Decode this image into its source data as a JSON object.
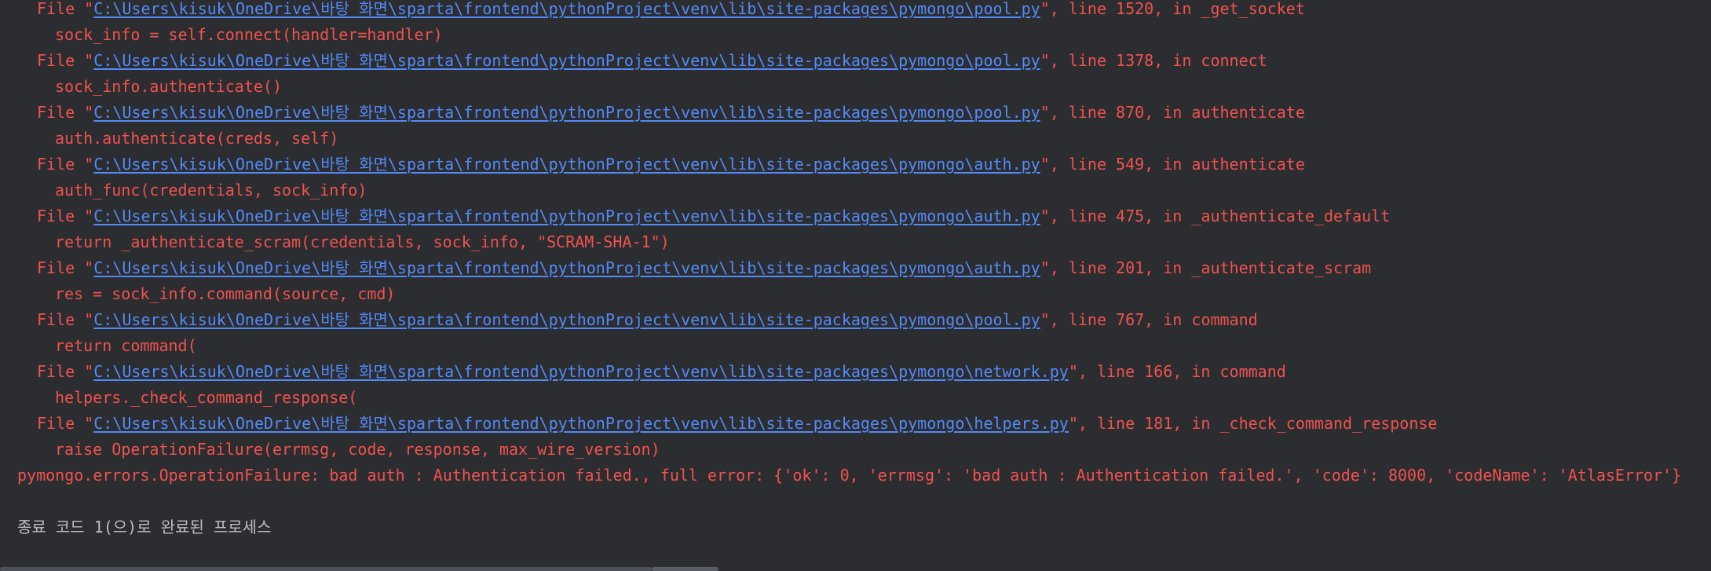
{
  "traceback": [
    {
      "kind": "file",
      "prefix": "File \"",
      "path": "C:\\Users\\kisuk\\OneDrive\\바탕 화면\\sparta\\frontend\\pythonProject\\venv\\lib\\site-packages\\pymongo\\pool.py",
      "suffix": "\", line 1520, in _get_socket"
    },
    {
      "kind": "code",
      "text": "sock_info = self.connect(handler=handler)"
    },
    {
      "kind": "file",
      "prefix": "File \"",
      "path": "C:\\Users\\kisuk\\OneDrive\\바탕 화면\\sparta\\frontend\\pythonProject\\venv\\lib\\site-packages\\pymongo\\pool.py",
      "suffix": "\", line 1378, in connect"
    },
    {
      "kind": "code",
      "text": "sock_info.authenticate()"
    },
    {
      "kind": "file",
      "prefix": "File \"",
      "path": "C:\\Users\\kisuk\\OneDrive\\바탕 화면\\sparta\\frontend\\pythonProject\\venv\\lib\\site-packages\\pymongo\\pool.py",
      "suffix": "\", line 870, in authenticate"
    },
    {
      "kind": "code",
      "text": "auth.authenticate(creds, self)"
    },
    {
      "kind": "file",
      "prefix": "File \"",
      "path": "C:\\Users\\kisuk\\OneDrive\\바탕 화면\\sparta\\frontend\\pythonProject\\venv\\lib\\site-packages\\pymongo\\auth.py",
      "suffix": "\", line 549, in authenticate"
    },
    {
      "kind": "code",
      "text": "auth_func(credentials, sock_info)"
    },
    {
      "kind": "file",
      "prefix": "File \"",
      "path": "C:\\Users\\kisuk\\OneDrive\\바탕 화면\\sparta\\frontend\\pythonProject\\venv\\lib\\site-packages\\pymongo\\auth.py",
      "suffix": "\", line 475, in _authenticate_default"
    },
    {
      "kind": "code",
      "text": "return _authenticate_scram(credentials, sock_info, \"SCRAM-SHA-1\")"
    },
    {
      "kind": "file",
      "prefix": "File \"",
      "path": "C:\\Users\\kisuk\\OneDrive\\바탕 화면\\sparta\\frontend\\pythonProject\\venv\\lib\\site-packages\\pymongo\\auth.py",
      "suffix": "\", line 201, in _authenticate_scram"
    },
    {
      "kind": "code",
      "text": "res = sock_info.command(source, cmd)"
    },
    {
      "kind": "file",
      "prefix": "File \"",
      "path": "C:\\Users\\kisuk\\OneDrive\\바탕 화면\\sparta\\frontend\\pythonProject\\venv\\lib\\site-packages\\pymongo\\pool.py",
      "suffix": "\", line 767, in command"
    },
    {
      "kind": "code",
      "text": "return command("
    },
    {
      "kind": "file",
      "prefix": "File \"",
      "path": "C:\\Users\\kisuk\\OneDrive\\바탕 화면\\sparta\\frontend\\pythonProject\\venv\\lib\\site-packages\\pymongo\\network.py",
      "suffix": "\", line 166, in command"
    },
    {
      "kind": "code",
      "text": "helpers._check_command_response("
    },
    {
      "kind": "file",
      "prefix": "File \"",
      "path": "C:\\Users\\kisuk\\OneDrive\\바탕 화면\\sparta\\frontend\\pythonProject\\venv\\lib\\site-packages\\pymongo\\helpers.py",
      "suffix": "\", line 181, in _check_command_response"
    },
    {
      "kind": "code",
      "text": "raise OperationFailure(errmsg, code, response, max_wire_version)"
    }
  ],
  "error_line": "pymongo.errors.OperationFailure: bad auth : Authentication failed., full error: {'ok': 0, 'errmsg': 'bad auth : Authentication failed.', 'code': 8000, 'codeName': 'AtlasError'}",
  "exit_message": "종료 코드 1(으)로 완료된 프로세스",
  "colors": {
    "background": "#2b2d30",
    "error_text": "#f0524f",
    "link": "#548af7",
    "normal_text": "#bcbec4"
  }
}
